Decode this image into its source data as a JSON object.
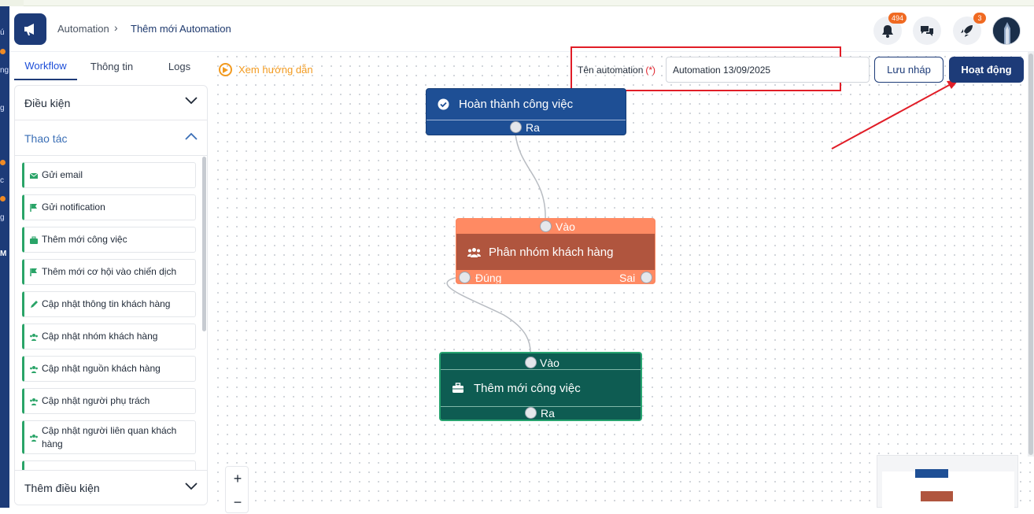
{
  "header": {
    "breadcrumb": [
      "Automation",
      "Thêm mới Automation"
    ],
    "notifications_badge": "494",
    "rocket_badge": "3"
  },
  "sidebar_rail": {
    "letters": [
      "ú",
      "ng",
      "g",
      "c",
      "g",
      "M"
    ]
  },
  "tabs": [
    {
      "label": "Workflow",
      "active": true
    },
    {
      "label": "Thông tin",
      "active": false
    },
    {
      "label": "Logs",
      "active": false
    }
  ],
  "panel": {
    "conditions_label": "Điều kiện",
    "actions_label": "Thao tác",
    "add_condition_label": "Thêm điều kiện",
    "actions": [
      {
        "label": "Gửi email",
        "icon": "envelope-icon"
      },
      {
        "label": "Gửi notification",
        "icon": "flag-icon"
      },
      {
        "label": "Thêm mới công việc",
        "icon": "briefcase-icon"
      },
      {
        "label": "Thêm mới cơ hội vào chiến dịch",
        "icon": "flag-icon"
      },
      {
        "label": "Cập nhật thông tin khách hàng",
        "icon": "pencil-icon"
      },
      {
        "label": "Cập nhật nhóm khách hàng",
        "icon": "users-icon"
      },
      {
        "label": "Cập nhật nguồn khách hàng",
        "icon": "users-icon"
      },
      {
        "label": "Cập nhật người phụ trách",
        "icon": "users-icon"
      },
      {
        "label": "Cập nhật người liên quan khách hàng",
        "icon": "users-icon"
      }
    ]
  },
  "toolbar": {
    "guide_label": "Xem hướng dẫn",
    "name_label": "Tên automation",
    "required_mark": "(*)",
    "name_value": "Automation 13/09/2025",
    "draft_label": "Lưu nháp",
    "activate_label": "Hoạt động"
  },
  "nodes": {
    "trigger": {
      "title": "Hoàn thành công việc",
      "out_label": "Ra",
      "color": "#1e4f95"
    },
    "condition": {
      "title": "Phân nhóm khách hàng",
      "in_label": "Vào",
      "true_label": "Đúng",
      "false_label": "Sai",
      "color": "#b0553e"
    },
    "action": {
      "title": "Thêm mới công việc",
      "in_label": "Vào",
      "out_label": "Ra",
      "color": "#0e5c52"
    }
  },
  "zoom": {
    "plus": "+",
    "minus": "−"
  },
  "colors": {
    "brand": "#1d3b78",
    "accent_orange": "#f29a1f",
    "highlight_red": "#e11d27",
    "action_green": "#2aa468"
  }
}
